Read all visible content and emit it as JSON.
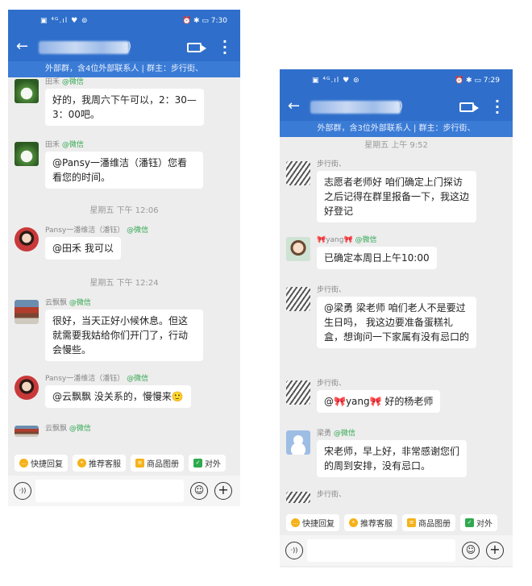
{
  "left": {
    "status": {
      "icons": "▣ ⁴ᴳ.ıl ♥ ⊚",
      "right": "⏰ ✱ ▭ 7:30"
    },
    "title_tail": "s)",
    "notice": "外部群，含4位外部联系人 | 群主：步行街、",
    "messages": [
      {
        "sender": "田禾",
        "tag": "@微信",
        "text": "好的，我周六下午可以，2：30—3：00吧。"
      },
      {
        "sender": "田禾",
        "tag": "@微信",
        "text": "@Pansy一潘维洁（潘钰）您看看您的时间。"
      },
      {
        "timestamp": "星期五 下午 12:06"
      },
      {
        "sender": "Pansy一潘维洁（潘钰）",
        "tag": "@微信",
        "text": "@田禾 我可以"
      },
      {
        "timestamp": "星期五 下午 12:24"
      },
      {
        "sender": "云飘飘",
        "tag": "@微信",
        "text": "很好，当天正好小候休息。但这就需要我姑给你们开门了，行动会慢些。"
      },
      {
        "sender": "Pansy一潘维洁（潘钰）",
        "tag": "@微信",
        "text": "@云飘飘 没关系的，慢慢来🙂"
      },
      {
        "sender": "云飘飘",
        "tag": "@微信",
        "text": ""
      }
    ],
    "tools": [
      "快捷回复",
      "推荐客服",
      "商品图册",
      "对外"
    ]
  },
  "right": {
    "status": {
      "icons": "▣ ⁴ᴳ.ıl ♥ ⊚",
      "right": "⏰ ✱ ▭ 7:29"
    },
    "title_tail": "s)",
    "notice": "外部群，含3位外部联系人 | 群主：步行街、",
    "messages": [
      {
        "timestamp": "星期五 上午 9:52"
      },
      {
        "sender": "步行街、",
        "tag": "",
        "text": "志愿者老师好 咱们确定上门探访之后记得在群里报备一下，我这边好登记"
      },
      {
        "sender": "🎀yang🎀",
        "tag": "@微信",
        "text": "已确定本周日上午10:00"
      },
      {
        "sender": "步行街、",
        "tag": "",
        "text": "@梁勇 梁老师 咱们老人不是要过生日吗， 我这边要准备蛋糕礼盒，想询问一下家属有没有忌口的"
      },
      {
        "sender": "步行街、",
        "tag": "",
        "text": "@🎀yang🎀 好的杨老师"
      },
      {
        "sender": "梁勇",
        "tag": "@微信",
        "text": "宋老师，早上好，非常感谢您们的周到安排，没有忌口。"
      },
      {
        "sender": "步行街、",
        "tag": "",
        "text": ""
      }
    ],
    "tools": [
      "快捷回复",
      "推荐客服",
      "商品图册",
      "对外"
    ]
  }
}
